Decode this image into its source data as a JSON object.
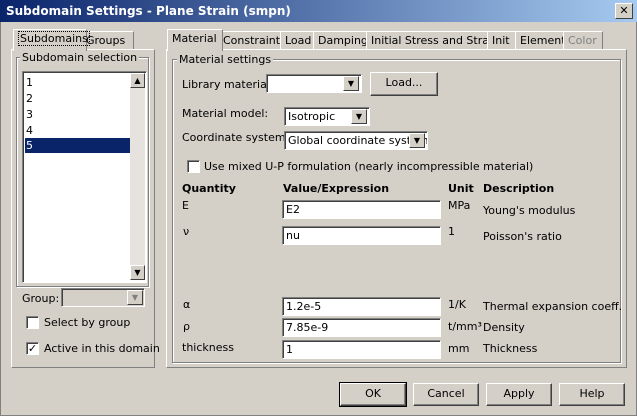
{
  "window": {
    "title": "Subdomain Settings - Plane Strain (smpn)",
    "close_glyph": "✕"
  },
  "left_tabs": [
    {
      "label": "Subdomains",
      "active": true
    },
    {
      "label": "Groups",
      "active": false
    }
  ],
  "subdomain_selection": {
    "group_label": "Subdomain selection",
    "items": [
      "1",
      "2",
      "3",
      "4",
      "5"
    ],
    "selected": "5",
    "group_field_label": "Group:",
    "group_value": "",
    "select_by_group_label": "Select by group",
    "select_by_group_checked": false,
    "active_in_domain_label": "Active in this domain",
    "active_in_domain_checked": true
  },
  "right_tabs": [
    {
      "label": "Material",
      "active": true,
      "disabled": false
    },
    {
      "label": "Constraint",
      "active": false,
      "disabled": false
    },
    {
      "label": "Load",
      "active": false,
      "disabled": false
    },
    {
      "label": "Damping",
      "active": false,
      "disabled": false
    },
    {
      "label": "Initial Stress and Strain",
      "active": false,
      "disabled": false
    },
    {
      "label": "Init",
      "active": false,
      "disabled": false
    },
    {
      "label": "Element",
      "active": false,
      "disabled": false
    },
    {
      "label": "Color",
      "active": false,
      "disabled": true
    }
  ],
  "material": {
    "group_label": "Material settings",
    "library_material_label": "Library material:",
    "library_material_value": "",
    "load_button": "Load...",
    "material_model_label": "Material model:",
    "material_model_value": "Isotropic",
    "coordinate_system_label": "Coordinate system:",
    "coordinate_system_value": "Global coordinate system",
    "mixed_up_label": "Use mixed U-P formulation (nearly incompressible material)",
    "mixed_up_checked": false,
    "headers": {
      "quantity": "Quantity",
      "value": "Value/Expression",
      "unit": "Unit",
      "description": "Description"
    },
    "rows": [
      {
        "quantity": "E",
        "value": "E2",
        "unit": "MPa",
        "description": "Young's modulus"
      },
      {
        "quantity": "ν",
        "value": "nu",
        "unit": "1",
        "description": "Poisson's ratio"
      },
      {
        "quantity": "α",
        "value": "1.2e-5",
        "unit": "1/K",
        "description": "Thermal expansion coeff."
      },
      {
        "quantity": "ρ",
        "value": "7.85e-9",
        "unit": "t/mm³",
        "description": "Density"
      },
      {
        "quantity": "thickness",
        "value": "1",
        "unit": "mm",
        "description": "Thickness"
      }
    ]
  },
  "buttons": {
    "ok": "OK",
    "cancel": "Cancel",
    "apply": "Apply",
    "help": "Help"
  }
}
